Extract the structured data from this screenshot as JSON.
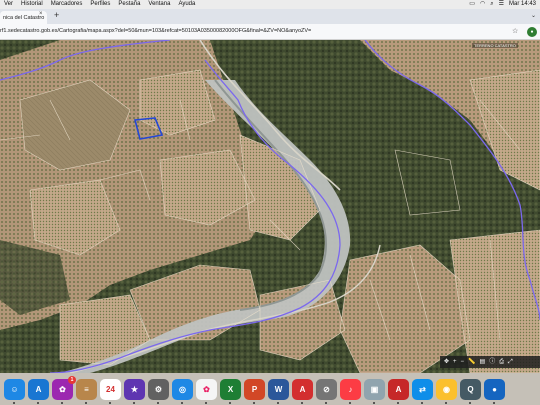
{
  "menubar": {
    "items": [
      "Ver",
      "Historial",
      "Marcadores",
      "Perfiles",
      "Pestaña",
      "Ventana",
      "Ayuda"
    ],
    "clock": "Mar 14:43"
  },
  "browser": {
    "tab_title": "nica del Catastro",
    "url": "rf1.sedecatastro.gob.es/Cartografia/mapa.aspx?del=50&mun=103&refcat=50103A03500082000OFG&final=&ZV=NO&anyoZV="
  },
  "map": {
    "corner_label": "TERRENO CATASTRO"
  },
  "dock": {
    "apps": [
      {
        "name": "finder",
        "color": "#1e88e5",
        "glyph": "☺"
      },
      {
        "name": "app-store",
        "color": "#1976d2",
        "glyph": "A"
      },
      {
        "name": "photos",
        "color": "#9c27b0",
        "glyph": "✿",
        "badge": "1"
      },
      {
        "name": "notes",
        "color": "#b8864b",
        "glyph": "≡"
      },
      {
        "name": "calendar",
        "color": "#ffffff",
        "glyph": "24",
        "text_color": "#d32f2f"
      },
      {
        "name": "imovie-star",
        "color": "#5e35b1",
        "glyph": "★"
      },
      {
        "name": "system-preferences",
        "color": "#616161",
        "glyph": "⚙"
      },
      {
        "name": "safari",
        "color": "#1e88e5",
        "glyph": "◎"
      },
      {
        "name": "photos-app",
        "color": "#f5f5f5",
        "glyph": "✿",
        "text_color": "#e91e63"
      },
      {
        "name": "excel",
        "color": "#1e7e34",
        "glyph": "X"
      },
      {
        "name": "powerpoint",
        "color": "#d24726",
        "glyph": "P"
      },
      {
        "name": "word",
        "color": "#2b579a",
        "glyph": "W"
      },
      {
        "name": "acrobat",
        "color": "#d32f2f",
        "glyph": "A"
      },
      {
        "name": "no-entry",
        "color": "#757575",
        "glyph": "⊘"
      },
      {
        "name": "music",
        "color": "#fc3c44",
        "glyph": "♪"
      },
      {
        "name": "preview",
        "color": "#90a4ae",
        "glyph": "▣"
      },
      {
        "name": "acrobat-reader",
        "color": "#c62828",
        "glyph": "A"
      },
      {
        "name": "teamviewer",
        "color": "#0e8ee9",
        "glyph": "⇄"
      },
      {
        "name": "chrome",
        "color": "#fbc02d",
        "glyph": "◉"
      },
      {
        "name": "quicktime",
        "color": "#455a64",
        "glyph": "Q"
      },
      {
        "name": "screen-app",
        "color": "#1565c0",
        "glyph": "●"
      }
    ]
  },
  "colors": {
    "cadastral_boundary": "#e8dcc8",
    "municipal_boundary": "#7b68ee",
    "selected_parcel": "#2447d6"
  }
}
